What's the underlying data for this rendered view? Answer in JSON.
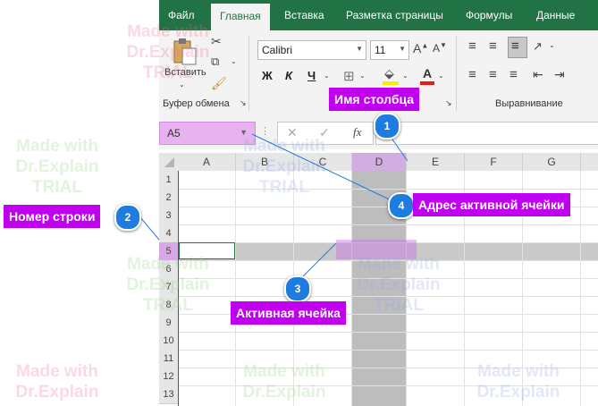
{
  "ribbon": {
    "tabs": [
      "Файл",
      "Главная",
      "Вставка",
      "Разметка страницы",
      "Формулы",
      "Данные"
    ],
    "paste_label": "Вставить",
    "clipboard_group": "Буфер обмена",
    "font_name": "Calibri",
    "font_size": "11",
    "bold": "Ж",
    "italic": "К",
    "underline": "Ч",
    "alignment_group": "Выравнивание"
  },
  "formula_bar": {
    "name_box_value": "A5",
    "fx": "fx"
  },
  "grid": {
    "columns": [
      "A",
      "B",
      "C",
      "D",
      "E",
      "F",
      "G"
    ],
    "rows": [
      "1",
      "2",
      "3",
      "4",
      "5",
      "6",
      "7",
      "8",
      "9",
      "10",
      "11",
      "12",
      "13"
    ]
  },
  "callouts": [
    {
      "number": "1",
      "label": "Имя столбца"
    },
    {
      "number": "2",
      "label": "Номер строки"
    },
    {
      "number": "3",
      "label": "Активная ячейка"
    },
    {
      "number": "4",
      "label": "Адрес активной ячейки"
    }
  ],
  "watermark": {
    "line1": "Made with",
    "line2": "Dr.Explain",
    "line3": "TRIAL"
  },
  "colors": {
    "excel_green": "#217346",
    "callout_label": "#c100f0",
    "callout_badge": "#1e7be0",
    "highlight": "#e8b2f0"
  }
}
